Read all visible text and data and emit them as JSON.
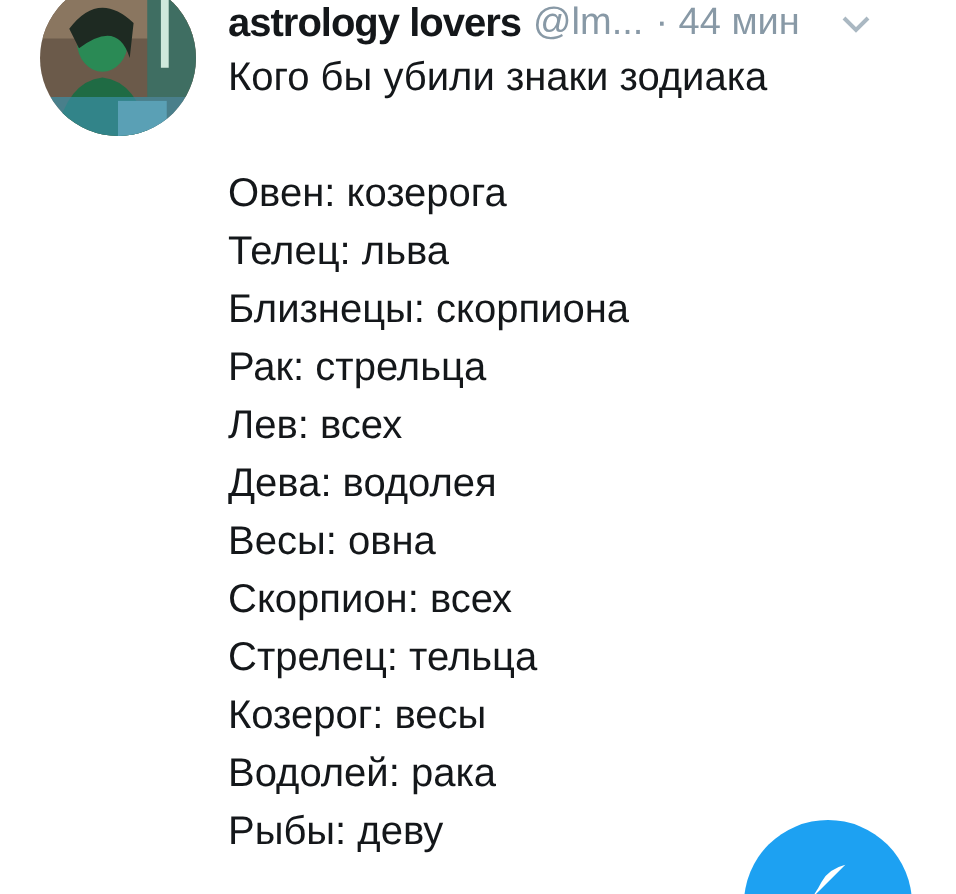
{
  "tweet": {
    "author": "astrology lovers",
    "handle": "@lm...",
    "time": "· 44 мин",
    "title": "Кого бы убили знаки зодиака",
    "lines": [
      "Овен: козерога",
      "Телец: льва",
      "Близнецы: скорпиона",
      "Рак: стрельца",
      "Лев: всех",
      "Дева: водолея",
      "Весы: овна",
      "Скорпион: всех",
      "Стрелец: тельца",
      "Козерог: весы",
      "Водолей: рака",
      "Рыбы: деву"
    ]
  }
}
